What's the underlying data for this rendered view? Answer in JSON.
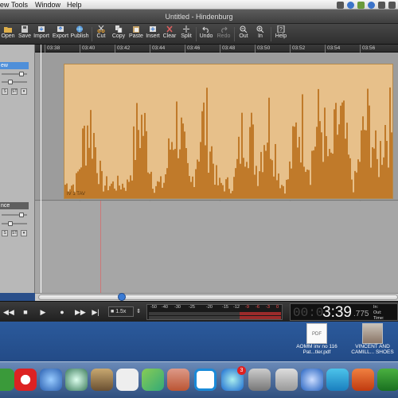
{
  "menubar": {
    "items": [
      "View",
      "Tools",
      "Window",
      "Help"
    ]
  },
  "window": {
    "title": "Untitled - Hindenburg"
  },
  "toolbar": {
    "buttons": [
      {
        "label": "Open",
        "icon": "folder-open-icon"
      },
      {
        "label": "Save",
        "icon": "save-icon"
      },
      {
        "label": "Import",
        "icon": "import-icon"
      },
      {
        "label": "Export",
        "icon": "export-icon"
      },
      {
        "label": "Publish",
        "icon": "globe-icon"
      },
      {
        "label": "Cut",
        "icon": "scissors-icon"
      },
      {
        "label": "Copy",
        "icon": "copy-icon"
      },
      {
        "label": "Paste",
        "icon": "paste-icon"
      },
      {
        "label": "Insert",
        "icon": "insert-icon"
      },
      {
        "label": "Clear",
        "icon": "clear-icon"
      },
      {
        "label": "Split",
        "icon": "split-icon"
      },
      {
        "label": "Undo",
        "icon": "undo-icon"
      },
      {
        "label": "Redo",
        "icon": "redo-icon"
      },
      {
        "label": "Out",
        "icon": "zoom-out-icon"
      },
      {
        "label": "In",
        "icon": "zoom-in-icon"
      },
      {
        "label": "Help",
        "icon": "help-icon"
      }
    ]
  },
  "ruler": {
    "ticks": [
      "03:38",
      "03:40",
      "03:42",
      "03:44",
      "03:46",
      "03:48",
      "03:50",
      "03:52",
      "03:54",
      "03:56"
    ]
  },
  "tracks": {
    "track1": {
      "name": "ew",
      "clip_label": "IV 1 TAV"
    },
    "track2": {
      "name": "nce"
    },
    "solo_label": "S",
    "mute_label": "M",
    "button_glyph": "ST"
  },
  "transport": {
    "speed": "1.5x",
    "meter_scale": [
      "-50",
      "-40",
      "-30",
      "-25",
      "-20",
      "-15",
      "-12",
      "-9",
      "-6",
      "-3",
      "0"
    ],
    "time_dim": "00:0",
    "time_main": "3:39",
    "time_ms": ".775",
    "labels": [
      "In:",
      "Out:",
      "Time:"
    ]
  },
  "desktop": {
    "files": [
      {
        "name": "AOMM inv no 116 Pat...tler.pdf",
        "thumb": "PDF"
      },
      {
        "name": "VINCENT AND CAMILL... SHOES",
        "thumb": ""
      }
    ]
  },
  "dock": {
    "badge": "3"
  },
  "colors": {
    "clip_bg": "#e7c08a",
    "waveform": "#c07a2a",
    "selection": "#4f8fd9"
  }
}
